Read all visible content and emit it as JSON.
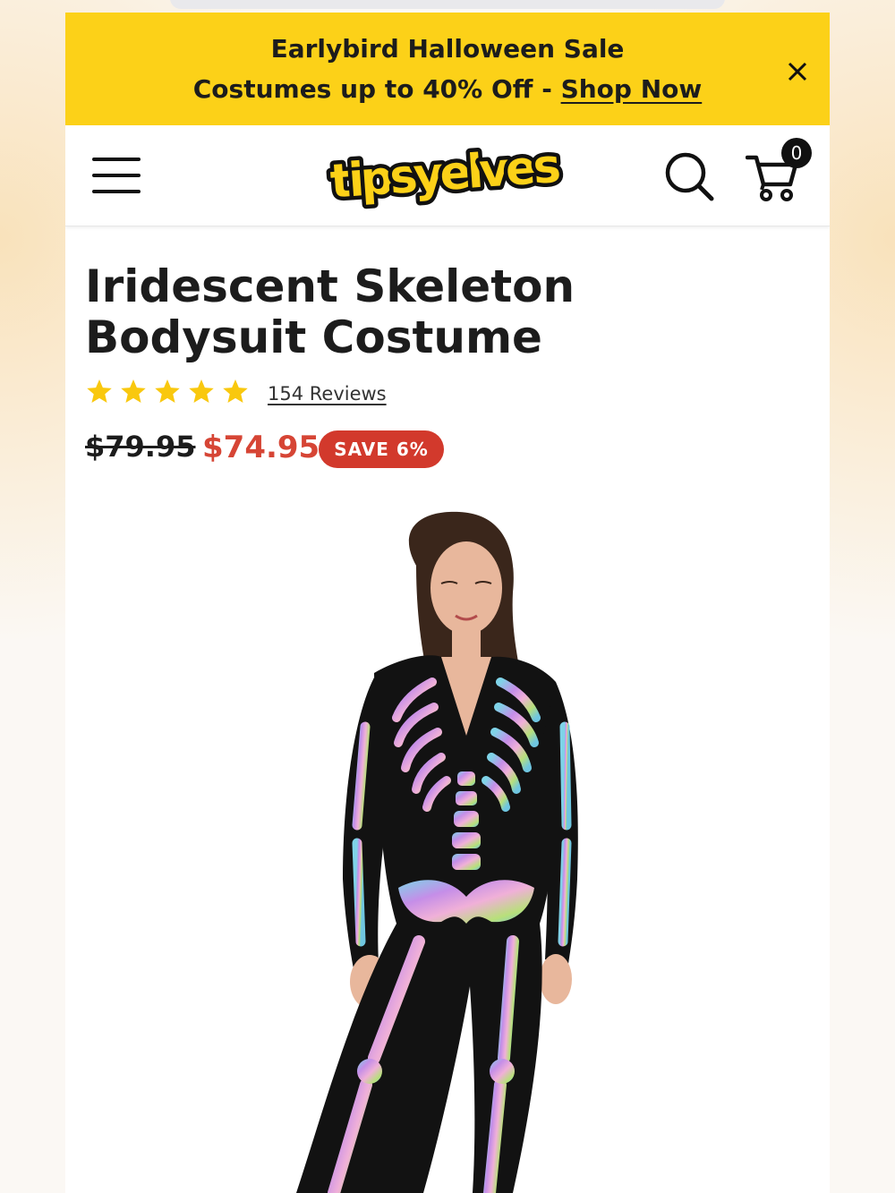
{
  "banner": {
    "line1": "Earlybird Halloween Sale",
    "line2_text": "Costumes up to 40% Off - ",
    "link_label": "Shop Now",
    "background": "#fcd118",
    "close_icon": "close-icon"
  },
  "header": {
    "logo_text": "tipsyelves",
    "cart_count": "0",
    "icons": [
      "hamburger-menu-icon",
      "search-icon",
      "cart-icon"
    ]
  },
  "product": {
    "title": "Iridescent Skeleton Bodysuit Costume",
    "rating": 5,
    "rating_max": 5,
    "reviews_label": "154 Reviews",
    "original_price": "$79.95",
    "sale_price": "$74.95",
    "save_badge": "SAVE 6%",
    "sale_color": "#d64535",
    "star_color": "#f9c80e"
  }
}
